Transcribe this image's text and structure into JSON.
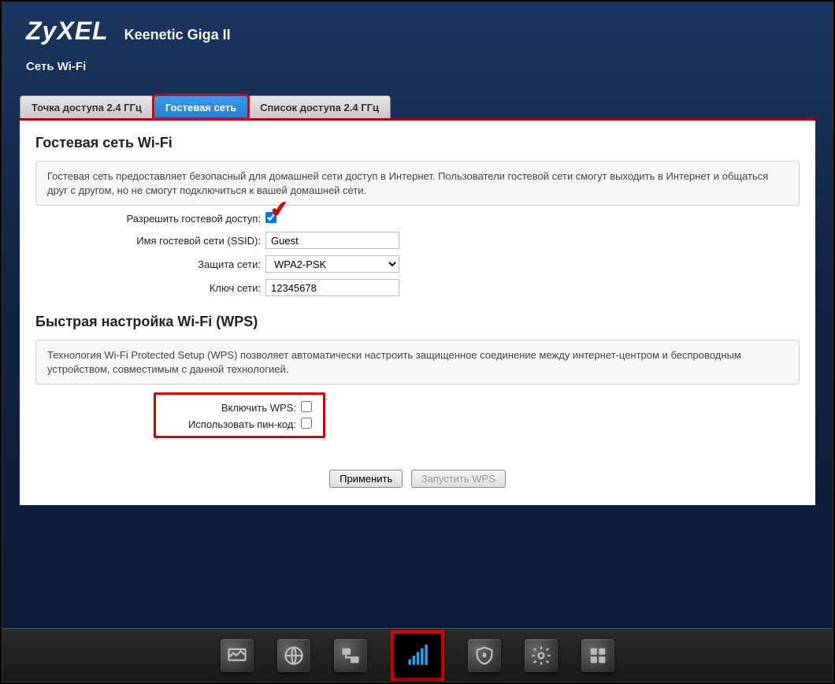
{
  "brand": {
    "logo": "ZyXEL",
    "model": "Keenetic Giga II"
  },
  "page_title": "Сеть Wi-Fi",
  "tabs": {
    "items": [
      {
        "label": "Точка доступа 2.4 ГГц",
        "active": false
      },
      {
        "label": "Гостевая сеть",
        "active": true
      },
      {
        "label": "Список доступа 2.4 ГГц",
        "active": false
      }
    ]
  },
  "guest": {
    "title": "Гостевая сеть Wi-Fi",
    "description": "Гостевая сеть предоставляет безопасный для домашней сети доступ в Интернет. Пользователи гостевой сети смогут выходить в Интернет и общаться друг с другом, но не смогут подключиться к вашей домашней сети.",
    "enable_label": "Разрешить гостевой доступ:",
    "enable_value": true,
    "ssid_label": "Имя гостевой сети (SSID):",
    "ssid_value": "Guest",
    "security_label": "Защита сети:",
    "security_value": "WPA2-PSK",
    "key_label": "Ключ сети:",
    "key_value": "12345678"
  },
  "wps": {
    "title": "Быстрая настройка Wi-Fi (WPS)",
    "description": "Технология Wi-Fi Protected Setup (WPS) позволяет автоматически настроить защищенное соединение между интернет-центром и беспроводным устройством, совместимым с данной технологией.",
    "enable_label": "Включить WPS:",
    "enable_value": false,
    "pin_label": "Использовать пин-код:",
    "pin_value": false
  },
  "buttons": {
    "apply": "Применить",
    "start_wps": "Запустить WPS"
  },
  "nav": {
    "items": [
      {
        "name": "monitor-icon"
      },
      {
        "name": "globe-icon"
      },
      {
        "name": "network-icon"
      },
      {
        "name": "wifi-icon",
        "active": true
      },
      {
        "name": "firewall-icon"
      },
      {
        "name": "gear-icon"
      },
      {
        "name": "apps-icon"
      }
    ]
  }
}
